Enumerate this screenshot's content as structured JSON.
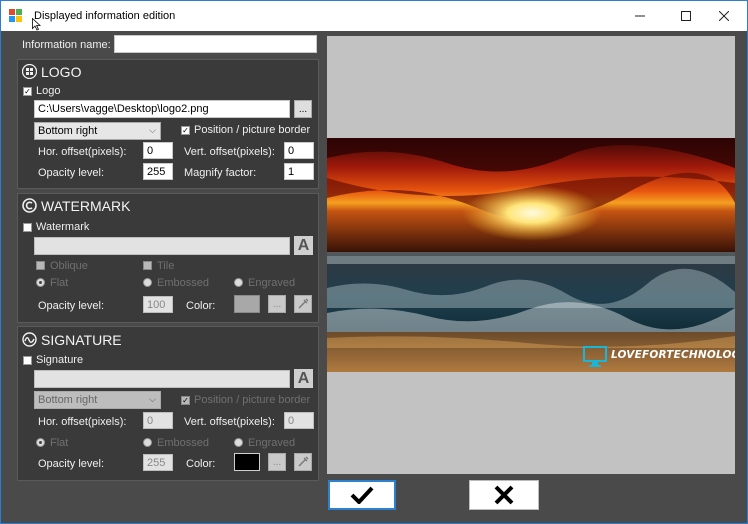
{
  "window": {
    "title": "Displayed information edition"
  },
  "info": {
    "label": "Information name:",
    "value": ""
  },
  "logo": {
    "title": "LOGO",
    "checkbox_label": "Logo",
    "path": "C:\\Users\\vagge\\Desktop\\logo2.png",
    "browse_label": "...",
    "position": "Bottom right",
    "border_label": "Position / picture border",
    "hor_label": "Hor. offset(pixels):",
    "hor_value": "0",
    "vert_label": "Vert. offset(pixels):",
    "vert_value": "0",
    "opacity_label": "Opacity level:",
    "opacity_value": "255",
    "magnify_label": "Magnify factor:",
    "magnify_value": "1"
  },
  "watermark": {
    "title": "WATERMARK",
    "checkbox_label": "Watermark",
    "text_value": "",
    "oblique_label": "Oblique",
    "tile_label": "Tile",
    "flat_label": "Flat",
    "embossed_label": "Embossed",
    "engraved_label": "Engraved",
    "opacity_label": "Opacity level:",
    "opacity_value": "100",
    "color_label": "Color:",
    "more_label": "..."
  },
  "signature": {
    "title": "SIGNATURE",
    "checkbox_label": "Signature",
    "text_value": "",
    "position": "Bottom right",
    "border_label": "Position / picture border",
    "hor_label": "Hor. offset(pixels):",
    "hor_value": "0",
    "vert_label": "Vert. offset(pixels):",
    "vert_value": "0",
    "flat_label": "Flat",
    "embossed_label": "Embossed",
    "engraved_label": "Engraved",
    "opacity_label": "Opacity level:",
    "opacity_value": "255",
    "color_label": "Color:",
    "more_label": "..."
  },
  "preview": {
    "logo_text": "LOVEFORTECHNOLOGY"
  },
  "colors": {
    "window_bg": "#4a4a4a",
    "panel_bg": "#3a3a3a",
    "preview_bg": "#c2c2c2",
    "watermark_color": "#a8a8a8",
    "signature_color": "#000000",
    "logo_accent": "#1ab6d8"
  }
}
